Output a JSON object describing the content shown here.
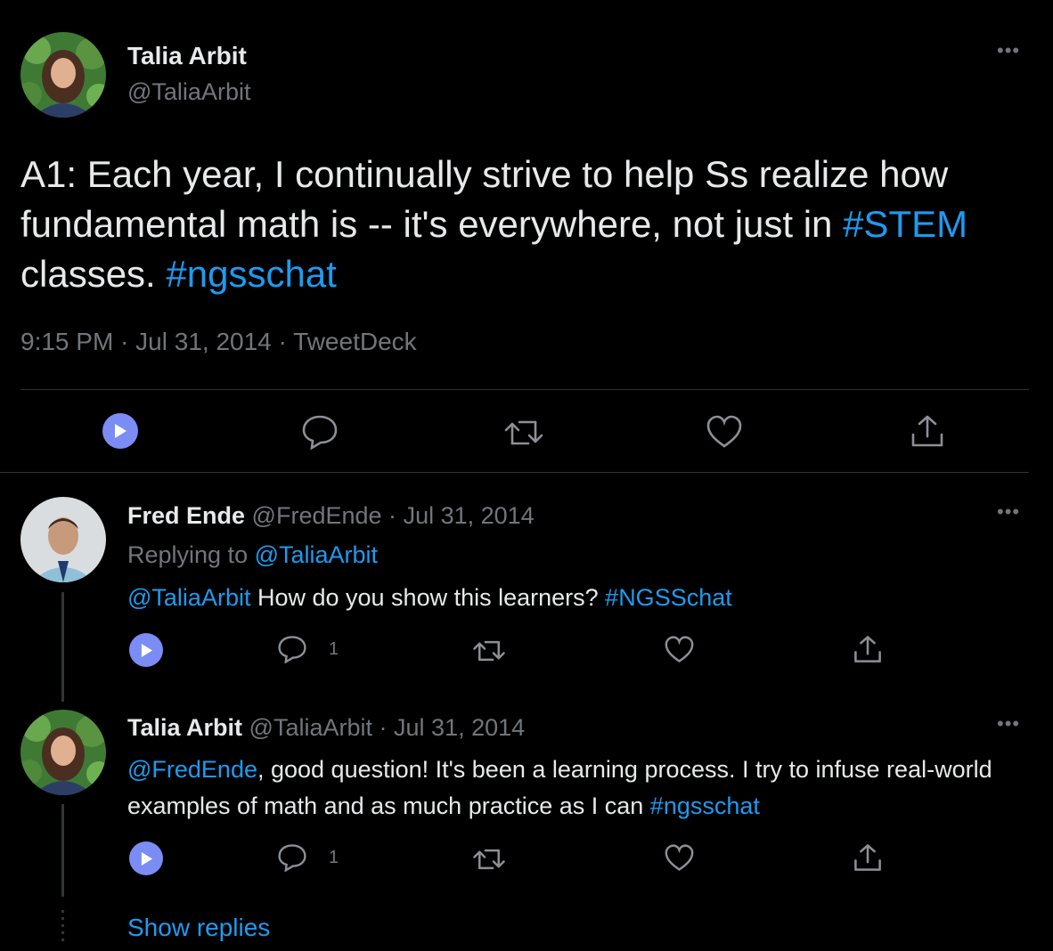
{
  "main_tweet": {
    "display_name": "Talia Arbit",
    "handle": "@TaliaArbit",
    "text_segments": [
      {
        "text": "A1: Each year, I continually strive to help Ss realize how fundamental math is -- it's everywhere, not just in ",
        "type": "text"
      },
      {
        "text": "#STEM",
        "type": "hashtag"
      },
      {
        "text": " classes. ",
        "type": "text"
      },
      {
        "text": "#ngsschat",
        "type": "hashtag"
      }
    ],
    "time": "9:15 PM",
    "date": "Jul 31, 2014",
    "source": "TweetDeck",
    "separator": "·"
  },
  "replies": [
    {
      "display_name": "Fred Ende",
      "handle": "@FredEnde",
      "date": "Jul 31, 2014",
      "replying_label": "Replying to ",
      "replying_to": "@TaliaArbit",
      "segments": [
        {
          "text": "@TaliaArbit",
          "type": "mention"
        },
        {
          "text": " How do you show this learners? ",
          "type": "text"
        },
        {
          "text": "#NGSSchat",
          "type": "hashtag"
        }
      ],
      "reply_count": "1"
    },
    {
      "display_name": "Talia Arbit",
      "handle": "@TaliaArbit",
      "date": "Jul 31, 2014",
      "segments": [
        {
          "text": "@FredEnde",
          "type": "mention"
        },
        {
          "text": ", good question! It's been a learning process. I try to infuse real-world examples of math and as much practice as I can ",
          "type": "text"
        },
        {
          "text": "#ngsschat",
          "type": "hashtag"
        }
      ],
      "reply_count": "1"
    }
  ],
  "show_replies": "Show replies",
  "icons": {
    "play": "play-icon",
    "reply": "reply-icon",
    "retweet": "retweet-icon",
    "like": "heart-icon",
    "share": "share-icon",
    "more": "more-icon"
  },
  "colors": {
    "background": "#000000",
    "text": "#e7e9ea",
    "muted": "#71767b",
    "link": "#1d9bf0",
    "play_button": "#7b8cf5"
  }
}
